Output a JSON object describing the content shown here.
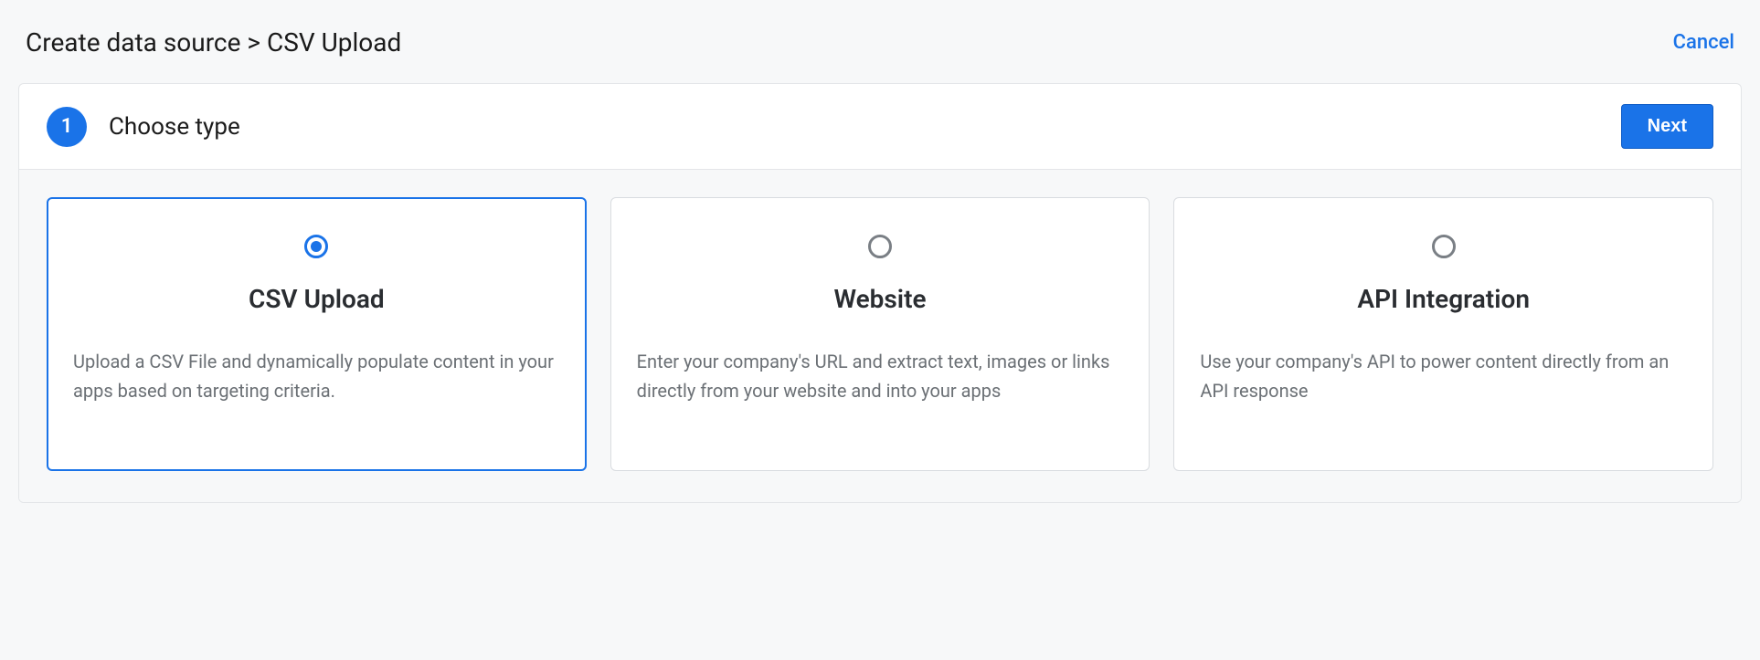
{
  "header": {
    "breadcrumb": "Create data source > CSV Upload",
    "cancel_label": "Cancel"
  },
  "step": {
    "number": "1",
    "title": "Choose type",
    "next_label": "Next"
  },
  "options": [
    {
      "title": "CSV Upload",
      "description": "Upload a CSV File and dynamically populate content in your apps based on targeting criteria.",
      "selected": true
    },
    {
      "title": "Website",
      "description": "Enter your company's URL and extract text, images or links directly from your website and into your apps",
      "selected": false
    },
    {
      "title": "API Integration",
      "description": "Use your company's API to power content directly from an API response",
      "selected": false
    }
  ]
}
